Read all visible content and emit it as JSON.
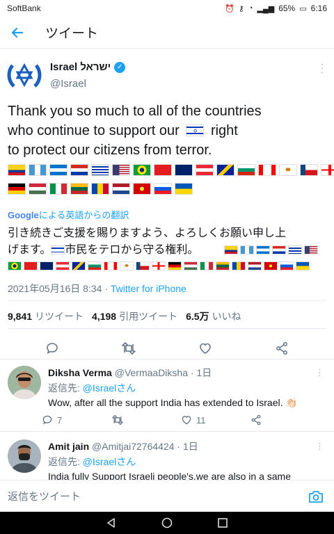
{
  "status_bar": {
    "carrier": "SoftBank",
    "battery": "65%",
    "time": "6:16"
  },
  "header": {
    "title": "ツイート"
  },
  "tweet": {
    "author_name": "Israel ישראל",
    "author_handle": "@Israel",
    "text_line1": "Thank you so much to all of the countries",
    "text_line2a": "who continue to support our",
    "text_line2b": "right",
    "text_line3": "to protect our citizens from terror.",
    "translate_brand": "Google",
    "translate_label": "による英語からの翻訳",
    "translated_line1": "引き続きご支援を賜りますよう、よろしくお願い申し上",
    "translated_line2a": "げます。",
    "translated_line2b": "市民をテロから守る権利。",
    "timestamp": "2021年05月16日 8:34",
    "separator": " · ",
    "source": "Twitter for iPhone",
    "retweets_count": "9,841",
    "retweets_label": "リツイート",
    "quotes_count": "4,198",
    "quotes_label": "引用ツイート",
    "likes_count": "6.5万",
    "likes_label": "いいね"
  },
  "flags_row1": [
    "colombia",
    "guatemala",
    "honduras",
    "paraguay",
    "uruguay",
    "usa",
    "brazil",
    "albania",
    "australia",
    "austria",
    "bosnia",
    "bulgaria",
    "canada",
    "cyprus",
    "czech",
    "georgia"
  ],
  "flags_row2": [
    "germany",
    "hungary",
    "italy",
    "lithuania",
    "moldova",
    "netherlands",
    "north-macedonia",
    "slovenia",
    "ukraine"
  ],
  "replies": [
    {
      "name": "Diksha Verma",
      "handle": "@VermaaDiksha",
      "time": "1日",
      "reply_prefix": "返信先: ",
      "reply_to": "@Israelさん",
      "text": "Wow, after all the support India has extended to Israel. 👏🏻",
      "comments": "7",
      "retweets": "",
      "likes": "11"
    },
    {
      "name": "Amit jain",
      "handle": "@Amitjai72764424",
      "time": "1日",
      "reply_prefix": "返信先: ",
      "reply_to": "@Israelさん",
      "text": "India fully Support Israeli people's,we are also in a same"
    }
  ],
  "compose": {
    "placeholder": "返信をツイート"
  },
  "colors": {
    "accent": "#1da1f2",
    "muted": "#657786",
    "text": "#14171a"
  }
}
